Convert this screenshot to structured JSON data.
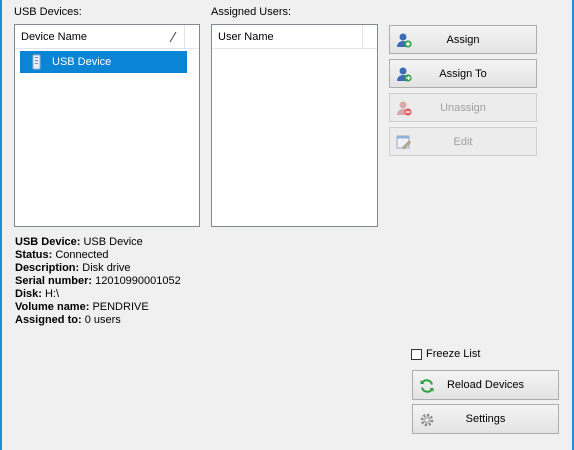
{
  "devices_label": "USB Devices:",
  "users_label": "Assigned Users:",
  "devices_list": {
    "header": "Device Name",
    "items": [
      {
        "name": "USB Device",
        "selected": true
      }
    ]
  },
  "users_list": {
    "header": "User Name",
    "items": []
  },
  "buttons": {
    "assign": "Assign",
    "assign_to": "Assign To",
    "unassign": "Unassign",
    "edit": "Edit",
    "reload": "Reload Devices",
    "settings": "Settings"
  },
  "device_info": {
    "usb_device_label": "USB Device:",
    "usb_device_value": "USB Device",
    "status_label": "Status:",
    "status_value": "Connected",
    "description_label": "Description:",
    "description_value": "Disk drive",
    "serial_label": "Serial number:",
    "serial_value": "12010990001052",
    "disk_label": "Disk:",
    "disk_value": "H:\\",
    "volume_label": "Volume name:",
    "volume_value": "PENDRIVE",
    "assigned_label": "Assigned to:",
    "assigned_value": "0 users"
  },
  "freeze_list": {
    "label": "Freeze List",
    "checked": false
  },
  "colors": {
    "accent": "#1c8fd6",
    "selection": "#0a84d4"
  }
}
